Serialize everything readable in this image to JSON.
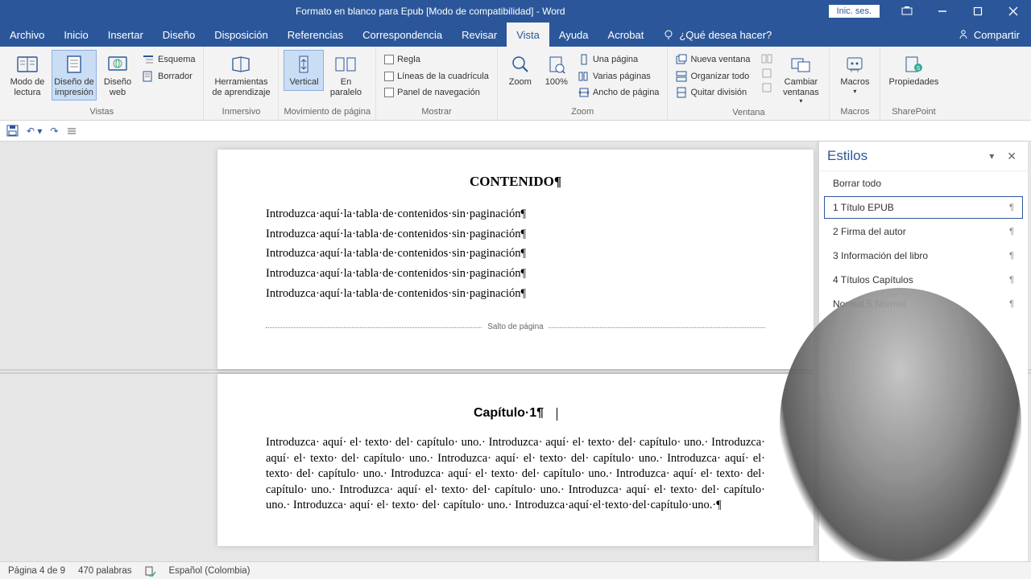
{
  "titlebar": {
    "title": "Formato en blanco para Epub [Modo de compatibilidad] - Word",
    "signin": "Inic. ses."
  },
  "menu": {
    "items": [
      "Archivo",
      "Inicio",
      "Insertar",
      "Diseño",
      "Disposición",
      "Referencias",
      "Correspondencia",
      "Revisar",
      "Vista",
      "Ayuda",
      "Acrobat"
    ],
    "active": "Vista",
    "tellme": "¿Qué desea hacer?",
    "share": "Compartir"
  },
  "ribbon": {
    "views": {
      "read": "Modo de lectura",
      "print": "Diseño de impresión",
      "web": "Diseño web",
      "outline": "Esquema",
      "draft": "Borrador",
      "label": "Vistas"
    },
    "immersive": {
      "tools": "Herramientas de aprendizaje",
      "label": "Inmersivo"
    },
    "pagemove": {
      "vertical": "Vertical",
      "parallel": "En paralelo",
      "label": "Movimiento de página"
    },
    "show": {
      "ruler": "Regla",
      "grid": "Líneas de la cuadrícula",
      "nav": "Panel de navegación",
      "label": "Mostrar"
    },
    "zoom": {
      "zoom": "Zoom",
      "hundred": "100%",
      "one": "Una página",
      "many": "Varias páginas",
      "width": "Ancho de página",
      "label": "Zoom"
    },
    "window": {
      "neww": "Nueva ventana",
      "arrange": "Organizar todo",
      "split": "Quitar división",
      "switch": "Cambiar ventanas",
      "label": "Ventana"
    },
    "macros": {
      "btn": "Macros",
      "label": "Macros"
    },
    "sp": {
      "btn": "Propiedades",
      "label": "SharePoint"
    }
  },
  "document": {
    "heading": "CONTENIDO¶",
    "toc_line": "Introduzca·aquí·la·tabla·de·contenidos·sin·paginación¶",
    "pagebreak": "Salto de página",
    "chapter_heading": "Capítulo·1¶",
    "chapter_text": "Introduzca· aquí· el· texto· del· capítulo· uno.· Introduzca· aquí· el· texto· del· capítulo· uno.· Introduzca· aquí· el· texto· del· capítulo· uno.· Introduzca· aquí· el· texto· del· capítulo· uno.· Introduzca· aquí· el· texto· del· capítulo· uno.· Introduzca· aquí· el· texto· del· capítulo· uno.· Introduzca· aquí· el· texto· del· capítulo· uno.· Introduzca· aquí· el· texto· del· capítulo· uno.· Introduzca· aquí· el· texto· del· capítulo· uno.· Introduzca· aquí· el· texto· del· capítulo· uno.· Introduzca·aquí·el·texto·del·capítulo·uno.·¶"
  },
  "styles": {
    "title": "Estilos",
    "clear": "Borrar todo",
    "items": [
      {
        "label": "1 Título EPUB",
        "selected": true
      },
      {
        "label": "2 Firma del autor",
        "selected": false
      },
      {
        "label": "3 Información del libro",
        "selected": false
      },
      {
        "label": "4 Títulos Capítulos",
        "selected": false
      },
      {
        "label": "Normal,5 Normal",
        "selected": false
      }
    ]
  },
  "status": {
    "page": "Página 4 de 9",
    "words": "470 palabras",
    "lang": "Español (Colombia)"
  }
}
